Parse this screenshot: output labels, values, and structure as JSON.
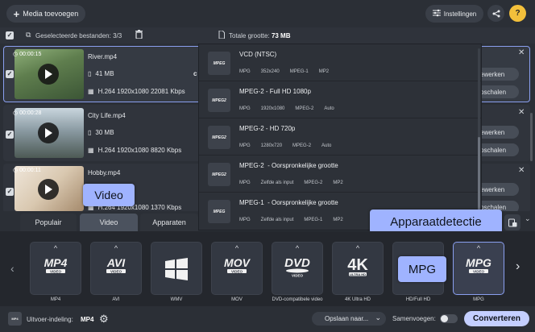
{
  "toolbar": {
    "add_media_label": "Media toevoegen",
    "settings_label": "Instellingen"
  },
  "selection": {
    "selected_files_label": "Geselecteerde bestanden: 3/3",
    "total_size_label": "Totale grootte:",
    "total_size_value": "73 MB"
  },
  "files": [
    {
      "duration": "00:00:15",
      "name": "River.mp4",
      "size": "41 MB",
      "codec": "H.264 1920x1080 22081 Kbps",
      "edit_label": "ewerken",
      "upscale_label": "pschalen"
    },
    {
      "duration": "00:00:28",
      "name": "City Life.mp4",
      "size": "30 MB",
      "codec": "H.264 1920x1080 8820 Kbps",
      "edit_label": "ewerken",
      "upscale_label": "pschalen"
    },
    {
      "duration": "00:00:11",
      "name": "Hobby.mp4",
      "codec": "H.264 1920x1080 1370 Kbps",
      "edit_label": "ewerken",
      "upscale_label": "pschalen"
    }
  ],
  "presets": [
    {
      "icon_text": "MPEG",
      "title": "VCD (NTSC)",
      "specs": [
        "MPG",
        "352x240",
        "MPEG-1",
        "MP2"
      ]
    },
    {
      "icon_text": "MPEG2",
      "title": "MPEG-2 - Full HD 1080p",
      "specs": [
        "MPG",
        "1920x1080",
        "MPEG-2",
        "Auto"
      ]
    },
    {
      "icon_text": "MPEG2",
      "title": "MPEG-2 - HD 720p",
      "specs": [
        "MPG",
        "1280x720",
        "MPEG-2",
        "Auto"
      ]
    },
    {
      "icon_text": "MPEG2",
      "title": "MPEG-2  - Oorspronkelijke grootte",
      "specs": [
        "MPG",
        "Zelfde als input",
        "MPEG-2",
        "MP2"
      ]
    },
    {
      "icon_text": "MPEG",
      "title": "MPEG-1  - Oorspronkelijke grootte",
      "specs": [
        "MPG",
        "Zelfde als input",
        "MPEG-1",
        "MP2"
      ]
    }
  ],
  "tabs": [
    "Populair",
    "Video",
    "Apparaten"
  ],
  "callouts": {
    "video": "Video",
    "device_detection": "Apparaatdetectie",
    "mpg": "MPG"
  },
  "formats": [
    {
      "logo": "MP4",
      "label": "MP4"
    },
    {
      "logo": "AVI",
      "label": "AVI"
    },
    {
      "logo": "windows",
      "label": "WMV"
    },
    {
      "logo": "MOV",
      "label": "MOV"
    },
    {
      "logo": "DVD",
      "label": "DVD-compatibele video"
    },
    {
      "logo": "4K",
      "label": "4K Ultra HD"
    },
    {
      "logo": "HD",
      "label": "HD/Full HD"
    },
    {
      "logo": "MPG",
      "label": "MPG"
    }
  ],
  "bottom": {
    "output_format_label": "Uitvoer-indeling:",
    "output_format_value": "MP4",
    "save_to_label": "Opslaan naar...",
    "merge_label": "Samenvoegen:",
    "convert_label": "Converteren"
  },
  "colors": {
    "accent": "#9fb3ff",
    "convert": "#c4cfff",
    "background": "#2b2f36"
  }
}
